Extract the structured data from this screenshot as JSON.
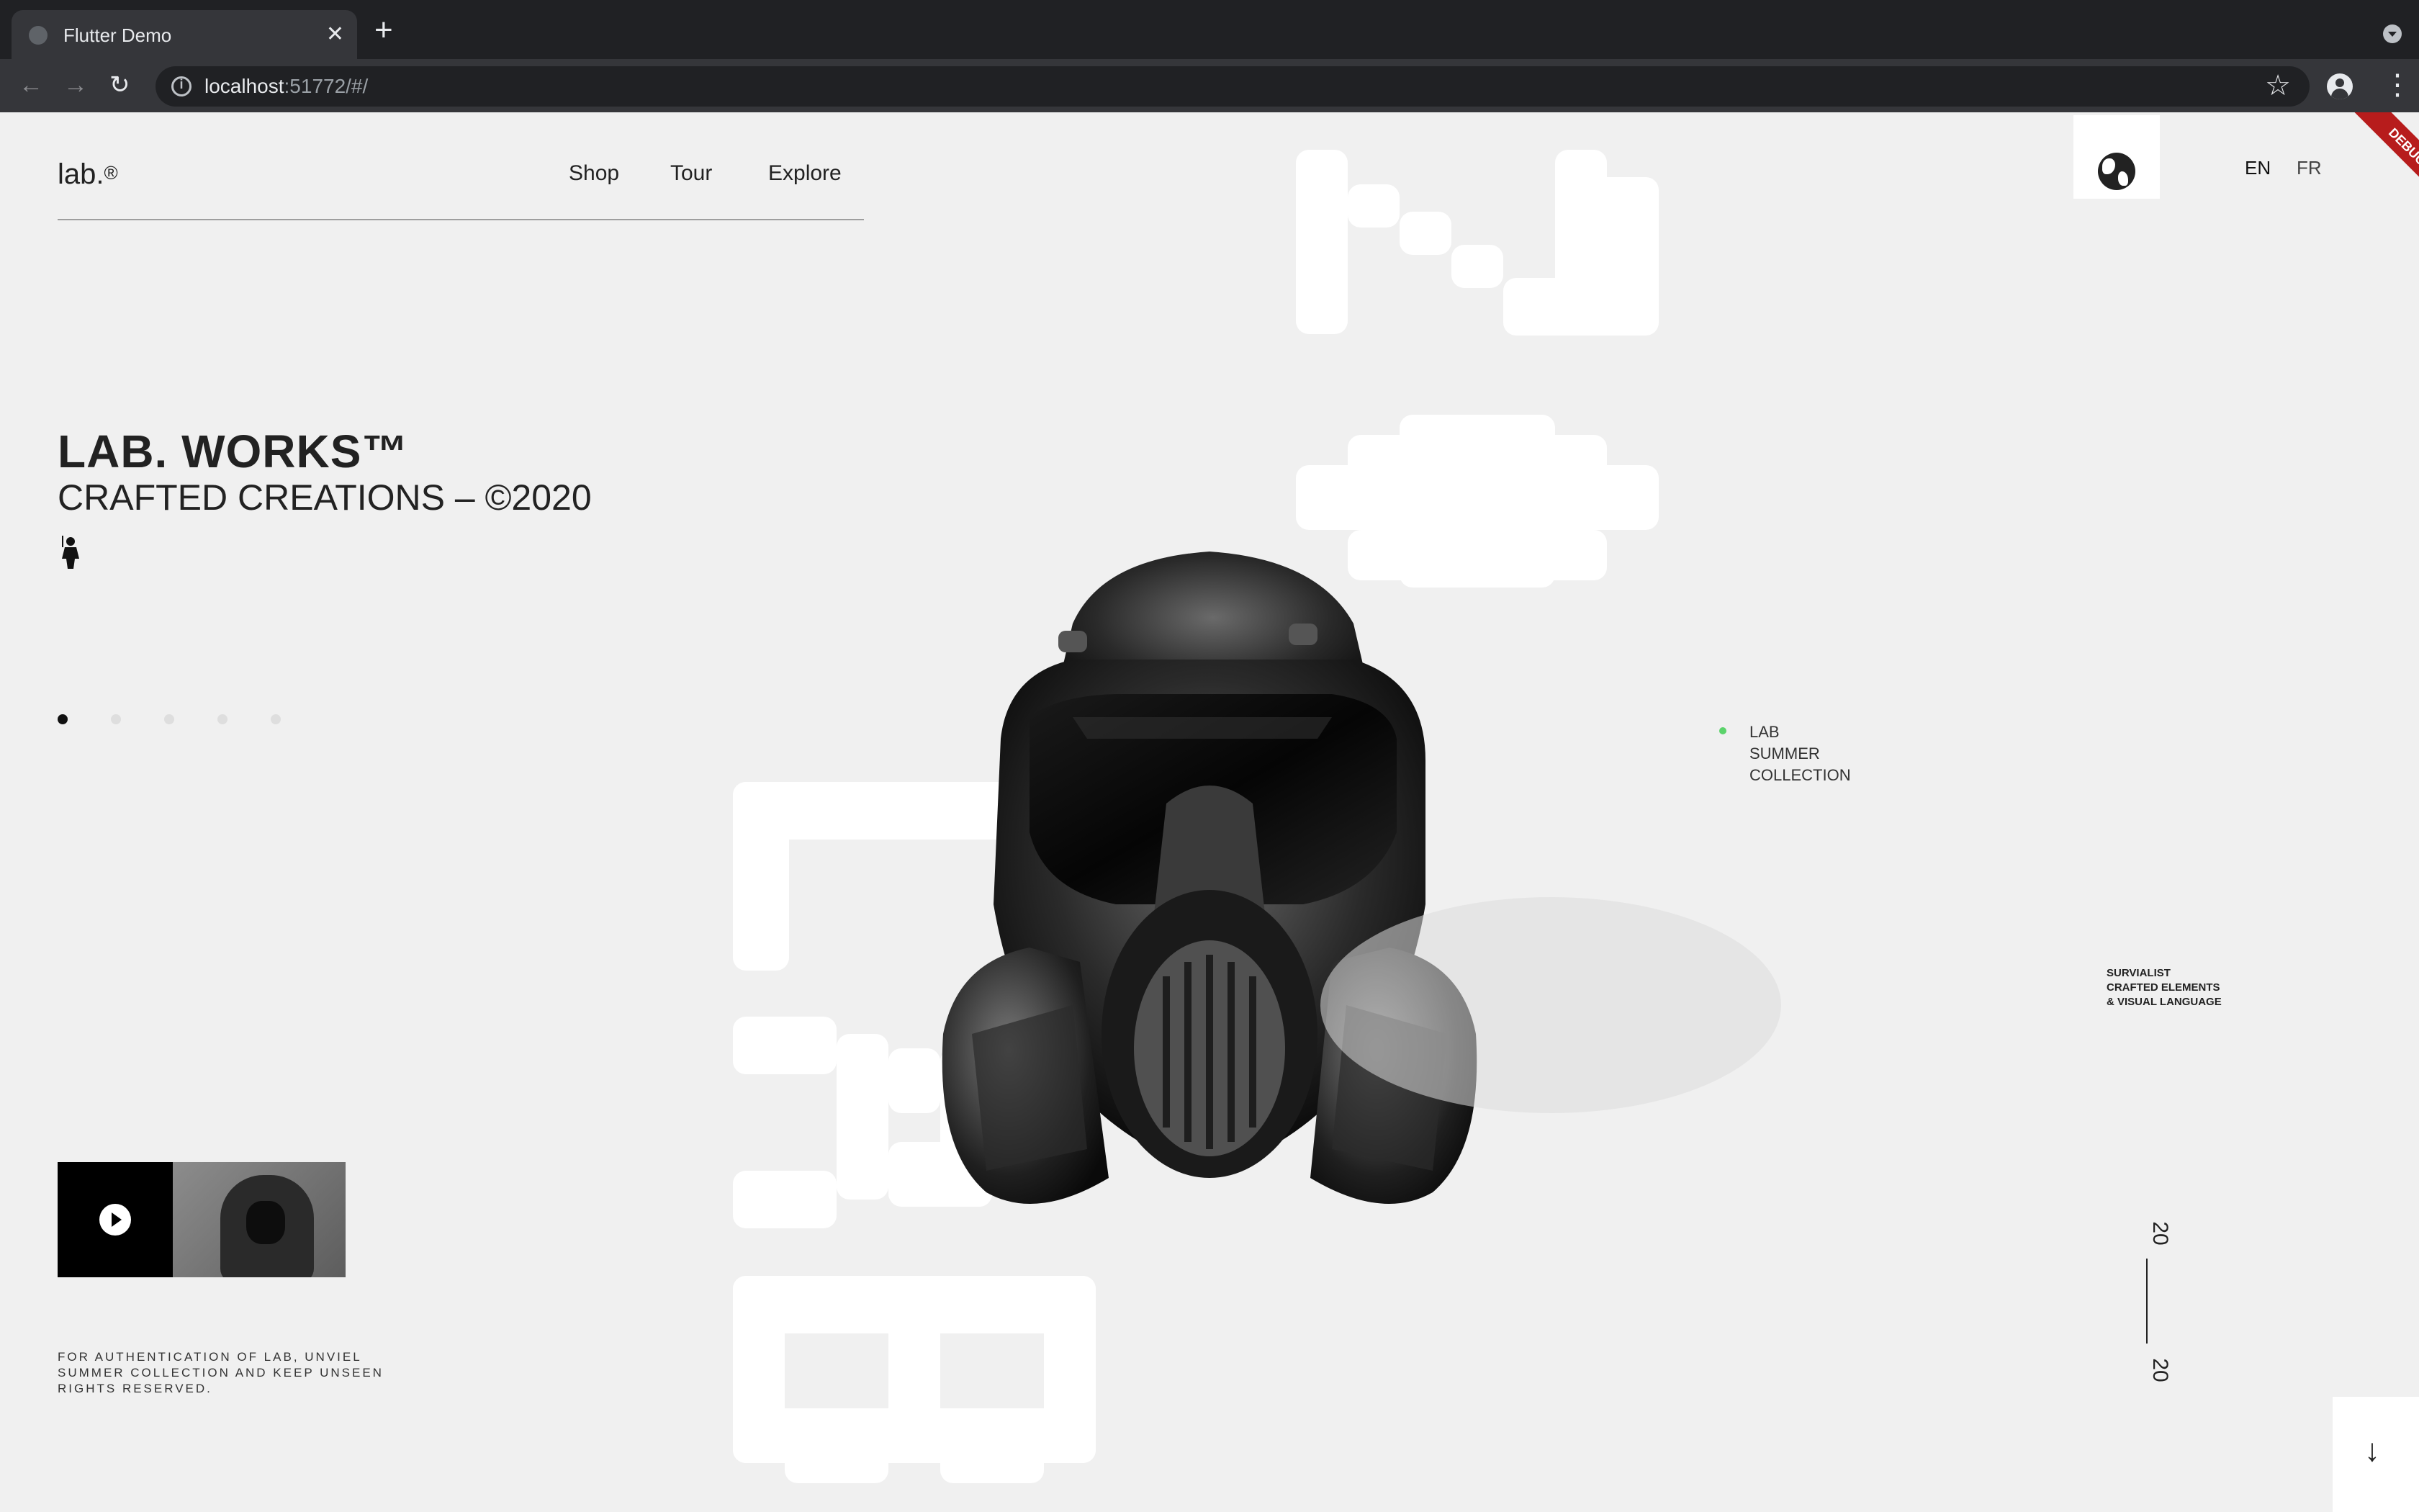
{
  "browser": {
    "tab_title": "Flutter Demo",
    "tab_close": "✕",
    "new_tab": "+",
    "url_host": "localhost",
    "url_rest": ":51772/#/"
  },
  "header": {
    "brand": "lab.",
    "brand_mark": "®",
    "nav": [
      "Shop",
      "Tour",
      "Explore"
    ],
    "languages": [
      "EN",
      "FR"
    ],
    "debug_banner": "DEBUG"
  },
  "hero": {
    "title": "LAB. WORKS™",
    "subtitle": "CRAFTED CREATIONS – ©2020"
  },
  "carousel": {
    "count": 5,
    "active_index": 0
  },
  "footnote": {
    "lines": [
      "FOR AUTHENTICATION OF LAB, UNVIEL",
      "SUMMER COLLECTION AND KEEP UNSEEN",
      "RIGHTS RESERVED."
    ]
  },
  "collection": {
    "lines": [
      "LAB",
      "SUMMER",
      "COLLECTION"
    ],
    "dot_color": "#5bd36b"
  },
  "tagline": {
    "lines": [
      "SURVIALIST",
      "CRAFTED ELEMENTS",
      "& VISUAL LANGUAGE"
    ]
  },
  "year": {
    "top": "20",
    "bottom": "20"
  },
  "icons": {
    "globe": "globe-icon",
    "play": "play-icon",
    "arrow_down": "arrow-down-icon",
    "star": "star-icon",
    "profile": "profile-icon"
  },
  "colors": {
    "page_background": "#f0f0f0",
    "text": "#222222",
    "debug_ribbon": "#b71c1c"
  }
}
